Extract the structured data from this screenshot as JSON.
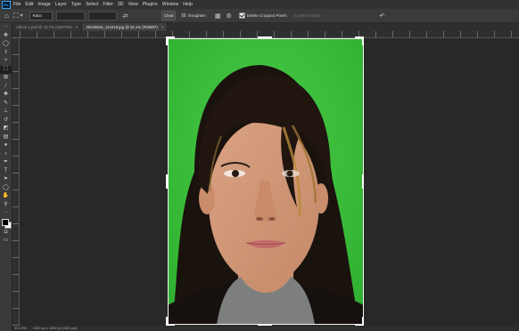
{
  "menubar": {
    "logo": "Ps",
    "items": [
      "File",
      "Edit",
      "Image",
      "Layer",
      "Type",
      "Select",
      "Filter",
      "3D",
      "View",
      "Plugins",
      "Window",
      "Help"
    ]
  },
  "options": {
    "ratio_label": "Ratio",
    "clear_label": "Clear",
    "straighten_label": "Straighten",
    "delete_cropped_label": "Delete Cropped Pixels",
    "content_aware_label": "Content-Aware"
  },
  "tabs": [
    {
      "label": "Album 1.psd @ 16.7% (CMYK/8)"
    },
    {
      "label": "20240516_144418.jpg @ 34.1% (RGB/8*)"
    }
  ],
  "status": {
    "zoom": "34.13%",
    "doc_info": "1200 px x 1800 px (300 ppi)"
  },
  "colors": {
    "accent": "#31a8ff",
    "canvas": "#282828",
    "backdrop": "#37c037"
  },
  "icons": {
    "home": "home-icon",
    "crop": "crop-icon",
    "swap": "swap-icon",
    "straighten": "straighten-icon",
    "overlay": "grid-icon",
    "settings": "gear-icon",
    "reset": "reset-icon"
  }
}
